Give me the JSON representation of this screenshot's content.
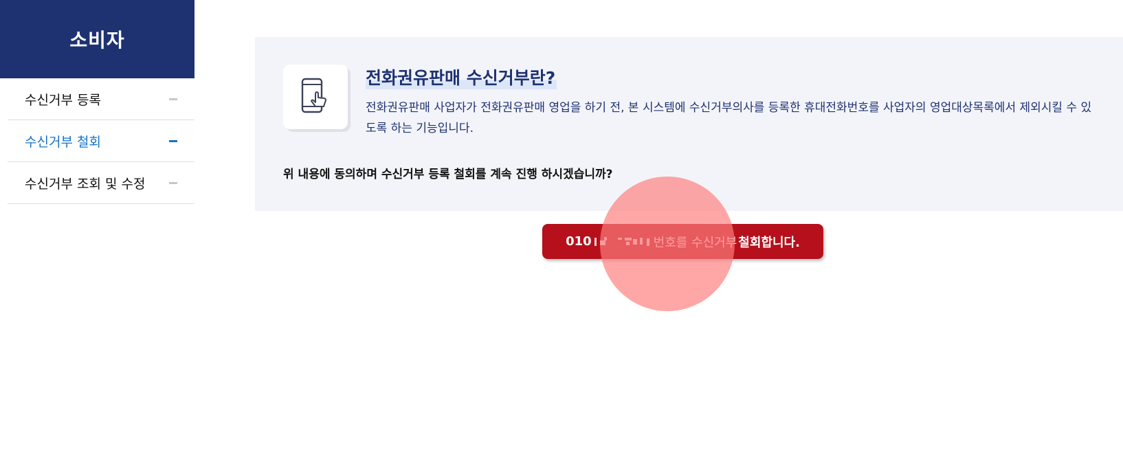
{
  "sidebar": {
    "title": "소비자",
    "items": [
      {
        "label": "수신거부 등록",
        "active": false
      },
      {
        "label": "수신거부 철회",
        "active": true
      },
      {
        "label": "수신거부 조회 및 수정",
        "active": false
      }
    ]
  },
  "info": {
    "icon": "phone-touch-icon",
    "title": "전화권유판매 수신거부란?",
    "description": "전화권유판매 사업자가 전화권유판매 영업을 하기 전, 본 시스템에 수신거부의사를 등록한 휴대전화번호를 사업자의 영업대상목록에서 제외시킬 수 있도록 하는 기능입니다.",
    "question": "위 내용에 동의하며 수신거부 등록 철회를 계속 진행 하시겠습니까?"
  },
  "action": {
    "phone_prefix": "010",
    "label_mid": "번호를 수신거부",
    "label_end": "철회합니다."
  },
  "colors": {
    "brand_navy": "#1e3272",
    "active_blue": "#1473c8",
    "button_red": "#b5101b",
    "panel_bg": "#f3f4f9"
  }
}
